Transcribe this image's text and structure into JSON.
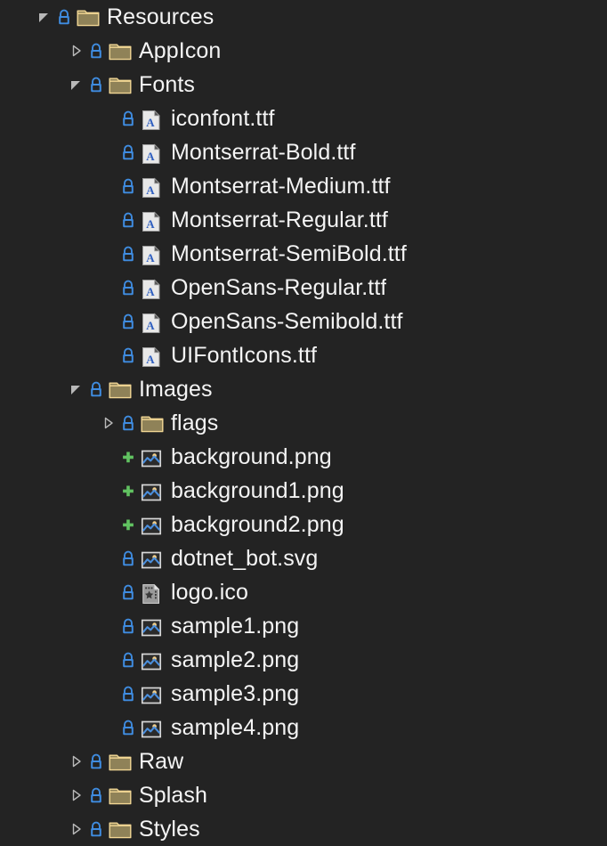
{
  "panel": {
    "name": "solution-explorer-tree",
    "background_color": "#232323",
    "text_color": "#f4f4f4"
  },
  "colors": {
    "lock": "#3f8ce0",
    "plus": "#61c261",
    "folder_fill": "#8f8258",
    "folder_border": "#f2d794",
    "expander": "#b8b8b8",
    "font_doc_fill": "#e8e8e8",
    "font_letter": "#2f5fc0",
    "image_border": "#d8d8d8",
    "image_fill": "#2b2b2b",
    "image_sun": "#f3cf8a",
    "image_mountain": "#4b8fdd",
    "ico_fill": "#9a9a9a"
  },
  "tree": [
    {
      "label": "Resources",
      "depth": 1,
      "kind": "folder",
      "expander": "expanded",
      "status": "lock"
    },
    {
      "label": "AppIcon",
      "depth": 2,
      "kind": "folder",
      "expander": "collapsed",
      "status": "lock"
    },
    {
      "label": "Fonts",
      "depth": 2,
      "kind": "folder",
      "expander": "expanded",
      "status": "lock"
    },
    {
      "label": "iconfont.ttf",
      "depth": 3,
      "kind": "font",
      "expander": "none",
      "status": "lock"
    },
    {
      "label": "Montserrat-Bold.ttf",
      "depth": 3,
      "kind": "font",
      "expander": "none",
      "status": "lock"
    },
    {
      "label": "Montserrat-Medium.ttf",
      "depth": 3,
      "kind": "font",
      "expander": "none",
      "status": "lock"
    },
    {
      "label": "Montserrat-Regular.ttf",
      "depth": 3,
      "kind": "font",
      "expander": "none",
      "status": "lock"
    },
    {
      "label": "Montserrat-SemiBold.ttf",
      "depth": 3,
      "kind": "font",
      "expander": "none",
      "status": "lock"
    },
    {
      "label": "OpenSans-Regular.ttf",
      "depth": 3,
      "kind": "font",
      "expander": "none",
      "status": "lock"
    },
    {
      "label": "OpenSans-Semibold.ttf",
      "depth": 3,
      "kind": "font",
      "expander": "none",
      "status": "lock"
    },
    {
      "label": "UIFontIcons.ttf",
      "depth": 3,
      "kind": "font",
      "expander": "none",
      "status": "lock"
    },
    {
      "label": "Images",
      "depth": 2,
      "kind": "folder",
      "expander": "expanded",
      "status": "lock"
    },
    {
      "label": "flags",
      "depth": 3,
      "kind": "folder",
      "expander": "collapsed",
      "status": "lock"
    },
    {
      "label": "background.png",
      "depth": 3,
      "kind": "image",
      "expander": "none",
      "status": "plus"
    },
    {
      "label": "background1.png",
      "depth": 3,
      "kind": "image",
      "expander": "none",
      "status": "plus"
    },
    {
      "label": "background2.png",
      "depth": 3,
      "kind": "image",
      "expander": "none",
      "status": "plus"
    },
    {
      "label": "dotnet_bot.svg",
      "depth": 3,
      "kind": "image",
      "expander": "none",
      "status": "lock"
    },
    {
      "label": "logo.ico",
      "depth": 3,
      "kind": "ico",
      "expander": "none",
      "status": "lock"
    },
    {
      "label": "sample1.png",
      "depth": 3,
      "kind": "image",
      "expander": "none",
      "status": "lock"
    },
    {
      "label": "sample2.png",
      "depth": 3,
      "kind": "image",
      "expander": "none",
      "status": "lock"
    },
    {
      "label": "sample3.png",
      "depth": 3,
      "kind": "image",
      "expander": "none",
      "status": "lock"
    },
    {
      "label": "sample4.png",
      "depth": 3,
      "kind": "image",
      "expander": "none",
      "status": "lock"
    },
    {
      "label": "Raw",
      "depth": 2,
      "kind": "folder",
      "expander": "collapsed",
      "status": "lock"
    },
    {
      "label": "Splash",
      "depth": 2,
      "kind": "folder",
      "expander": "collapsed",
      "status": "lock"
    },
    {
      "label": "Styles",
      "depth": 2,
      "kind": "folder",
      "expander": "collapsed",
      "status": "lock"
    }
  ],
  "icon_names": {
    "folder": "folder-icon",
    "font": "font-file-icon",
    "image": "image-file-icon",
    "ico": "icon-file-icon",
    "lock": "lock-icon",
    "plus": "plus-icon",
    "expanded": "chevron-expanded-icon",
    "collapsed": "chevron-collapsed-icon"
  }
}
